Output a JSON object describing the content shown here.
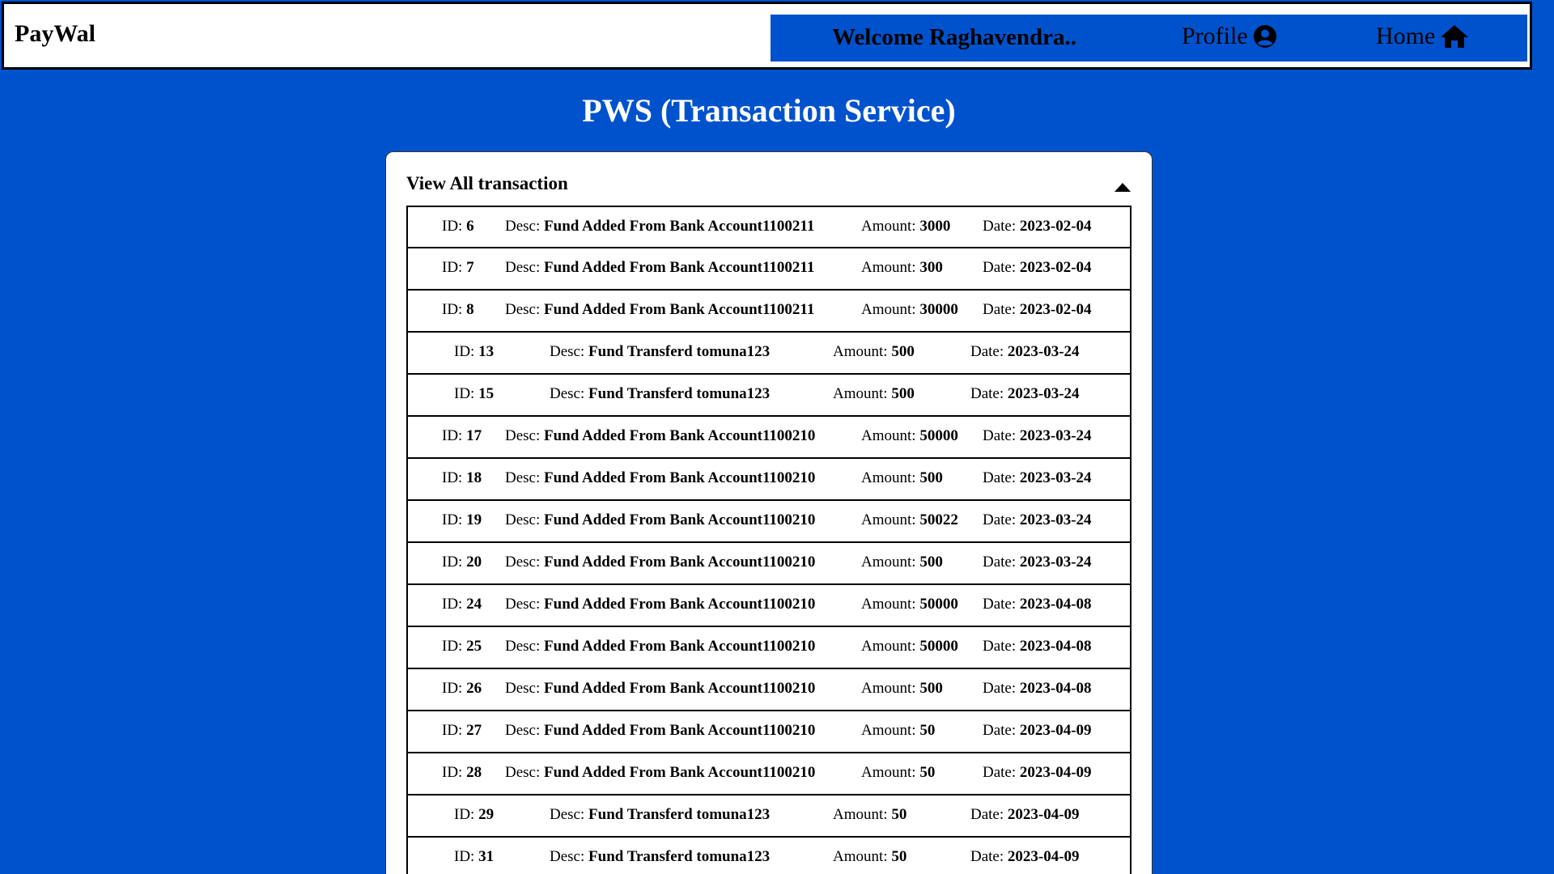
{
  "navbar": {
    "brand": "PayWal",
    "welcome": "Welcome Raghavendra..",
    "profile_label": "Profile",
    "home_label": "Home"
  },
  "page": {
    "title": "PWS (Transaction Service)"
  },
  "transactions": {
    "header": "View All transaction",
    "labels": {
      "id": "ID:",
      "desc": "Desc:",
      "amount": "Amount:",
      "date": "Date:"
    },
    "rows": [
      {
        "id": "6",
        "desc": "Fund Added From Bank Account1100211",
        "amount": "3000",
        "date": "2023-02-04"
      },
      {
        "id": "7",
        "desc": "Fund Added From Bank Account1100211",
        "amount": "300",
        "date": "2023-02-04"
      },
      {
        "id": "8",
        "desc": "Fund Added From Bank Account1100211",
        "amount": "30000",
        "date": "2023-02-04"
      },
      {
        "id": "13",
        "desc": "Fund Transferd tomuna123",
        "amount": "500",
        "date": "2023-03-24"
      },
      {
        "id": "15",
        "desc": "Fund Transferd tomuna123",
        "amount": "500",
        "date": "2023-03-24"
      },
      {
        "id": "17",
        "desc": "Fund Added From Bank Account1100210",
        "amount": "50000",
        "date": "2023-03-24"
      },
      {
        "id": "18",
        "desc": "Fund Added From Bank Account1100210",
        "amount": "500",
        "date": "2023-03-24"
      },
      {
        "id": "19",
        "desc": "Fund Added From Bank Account1100210",
        "amount": "50022",
        "date": "2023-03-24"
      },
      {
        "id": "20",
        "desc": "Fund Added From Bank Account1100210",
        "amount": "500",
        "date": "2023-03-24"
      },
      {
        "id": "24",
        "desc": "Fund Added From Bank Account1100210",
        "amount": "50000",
        "date": "2023-04-08"
      },
      {
        "id": "25",
        "desc": "Fund Added From Bank Account1100210",
        "amount": "50000",
        "date": "2023-04-08"
      },
      {
        "id": "26",
        "desc": "Fund Added From Bank Account1100210",
        "amount": "500",
        "date": "2023-04-08"
      },
      {
        "id": "27",
        "desc": "Fund Added From Bank Account1100210",
        "amount": "50",
        "date": "2023-04-09"
      },
      {
        "id": "28",
        "desc": "Fund Added From Bank Account1100210",
        "amount": "50",
        "date": "2023-04-09"
      },
      {
        "id": "29",
        "desc": "Fund Transferd tomuna123",
        "amount": "50",
        "date": "2023-04-09"
      },
      {
        "id": "31",
        "desc": "Fund Transferd tomuna123",
        "amount": "50",
        "date": "2023-04-09"
      }
    ]
  },
  "icons": {
    "profile": "user-circle-icon",
    "home": "home-icon",
    "collapse": "caret-up-icon"
  },
  "colors": {
    "accent": "#0052cc",
    "card": "#ffffff"
  }
}
